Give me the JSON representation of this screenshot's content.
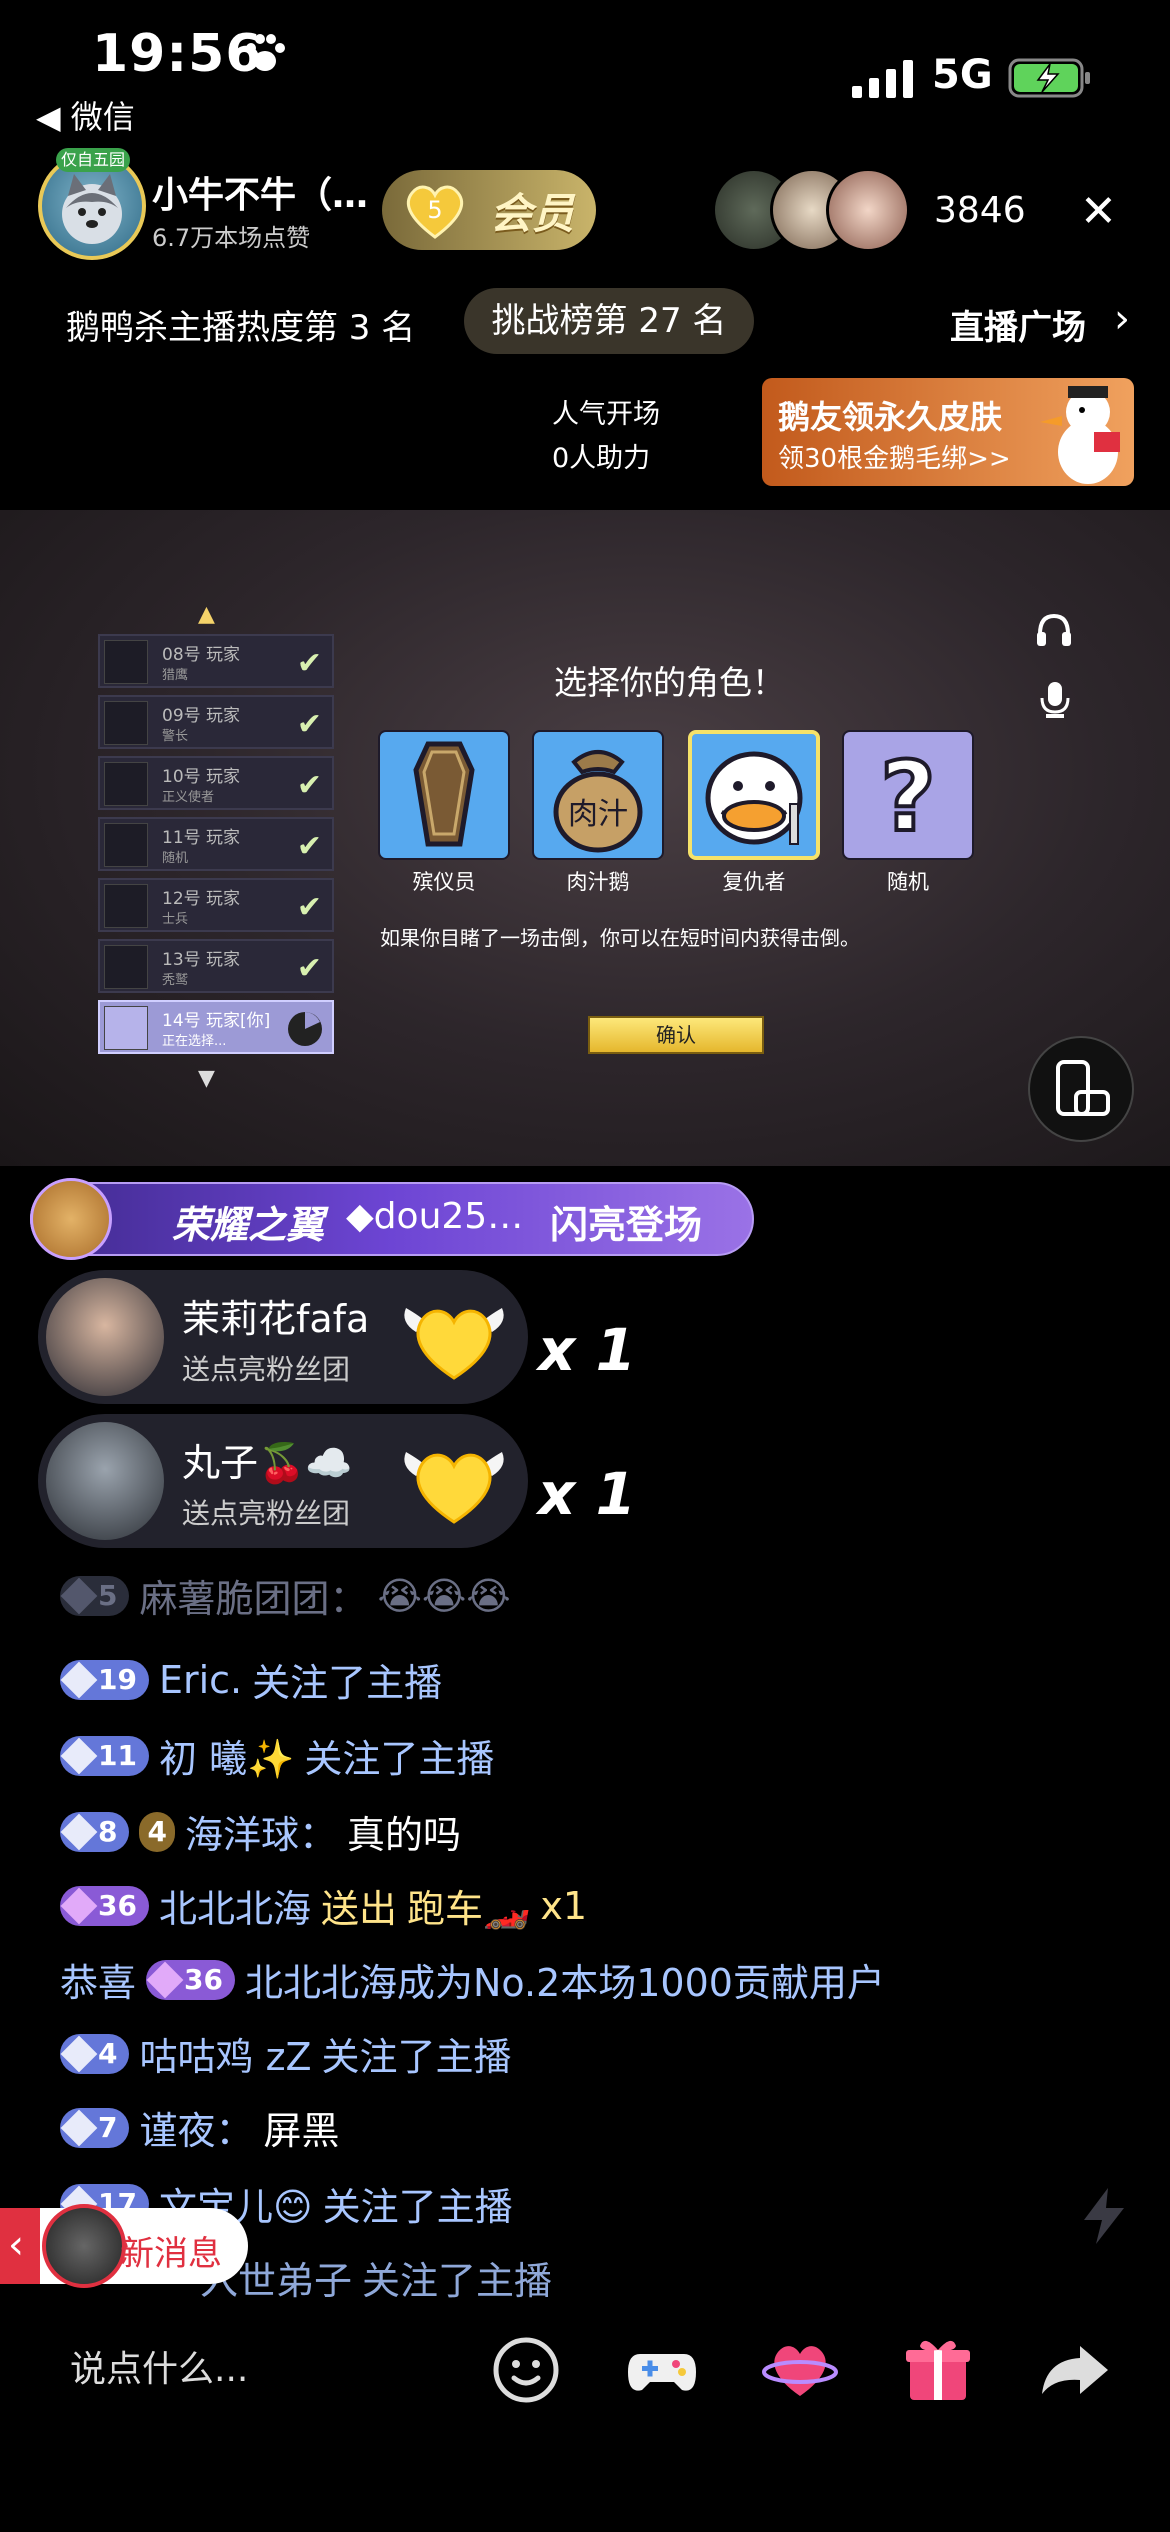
{
  "status_bar": {
    "time": "19:56",
    "back_app": "◀ 微信",
    "network": "5G"
  },
  "header": {
    "host_name": "小牛不牛（…",
    "host_likes": "6.7万本场点赞",
    "avatar_badge": "仅自五园",
    "level_number": "5",
    "member_label": "会员",
    "viewer_count": "3846",
    "close_symbol": "✕"
  },
  "rank_row": {
    "hot_rank": "鹅鸭杀主播热度第 3 名",
    "challenge": "挑战榜第 27 名",
    "plaza": "直播广场",
    "plaza_chevron": "›"
  },
  "popularity": {
    "line1": "人气开场",
    "line2": "0人助力"
  },
  "promo": {
    "title": "鹅友领永久皮肤",
    "subtitle": "领30根金鹅毛绑>>"
  },
  "game": {
    "title": "选择你的角色！",
    "players": [
      {
        "name": "08号 玩家",
        "role": "猎鹰"
      },
      {
        "name": "09号 玩家",
        "role": "警长"
      },
      {
        "name": "10号 玩家",
        "role": "正义使者"
      },
      {
        "name": "11号 玩家",
        "role": "随机"
      },
      {
        "name": "12号 玩家",
        "role": "士兵"
      },
      {
        "name": "13号 玩家",
        "role": "秃鹫"
      },
      {
        "name": "14号 玩家[你]",
        "role": "正在选择..."
      }
    ],
    "roles": [
      {
        "label": "殡仪员"
      },
      {
        "label": "肉汁鹅",
        "icon_text": "肉汁"
      },
      {
        "label": "复仇者"
      },
      {
        "label": "随机",
        "icon_text": "?"
      }
    ],
    "hint": "如果你目睹了一场击倒，你可以在短时间内获得击倒。",
    "confirm": "确认",
    "check_symbol": "✔",
    "up_arrow": "▲",
    "down_arrow": "▼"
  },
  "chat": {
    "glory": {
      "title": "荣耀之翼",
      "user": "◆dou25…",
      "action": "闪亮登场"
    },
    "gifts": [
      {
        "name": "茉莉花fafa",
        "sub": "送点亮粉丝团",
        "count": "x 1"
      },
      {
        "name": "丸子🍒☁️",
        "sub": "送点亮粉丝团",
        "count": "x 1"
      }
    ],
    "messages": [
      {
        "level": "5",
        "name": "麻薯脆团团：",
        "text": "😭😭😭"
      },
      {
        "level": "19",
        "name": "Eric.",
        "text": "关注了主播"
      },
      {
        "level": "11",
        "name": "初 曦✨",
        "text": "关注了主播"
      },
      {
        "level": "8",
        "fan_level": "4",
        "name": "海洋球：",
        "text": "真的吗"
      },
      {
        "level": "36",
        "name": "北北北海",
        "action": "送出",
        "gift": "跑车🏎️",
        "count": "x1"
      },
      {
        "prefix": "恭喜",
        "level": "36",
        "text": "北北北海成为No.2本场1000贡献用户"
      },
      {
        "level": "4",
        "name": "咕咕鸡 zZ",
        "text": "关注了主播"
      },
      {
        "level": "7",
        "name": "谨夜：",
        "text": "屏黑"
      },
      {
        "level": "17",
        "name": "文宝儿😊",
        "text": "关注了主播"
      },
      {
        "name": "入世弟子",
        "text": "关注了主播"
      }
    ],
    "new_message": "新消息",
    "new_message_chevron": "‹"
  },
  "input_bar": {
    "placeholder": "说点什么..."
  },
  "colors": {
    "accent_blue": "#6477d9",
    "accent_purple": "#8a5ad6",
    "gold": "#ffe48a",
    "red": "#e03040"
  }
}
